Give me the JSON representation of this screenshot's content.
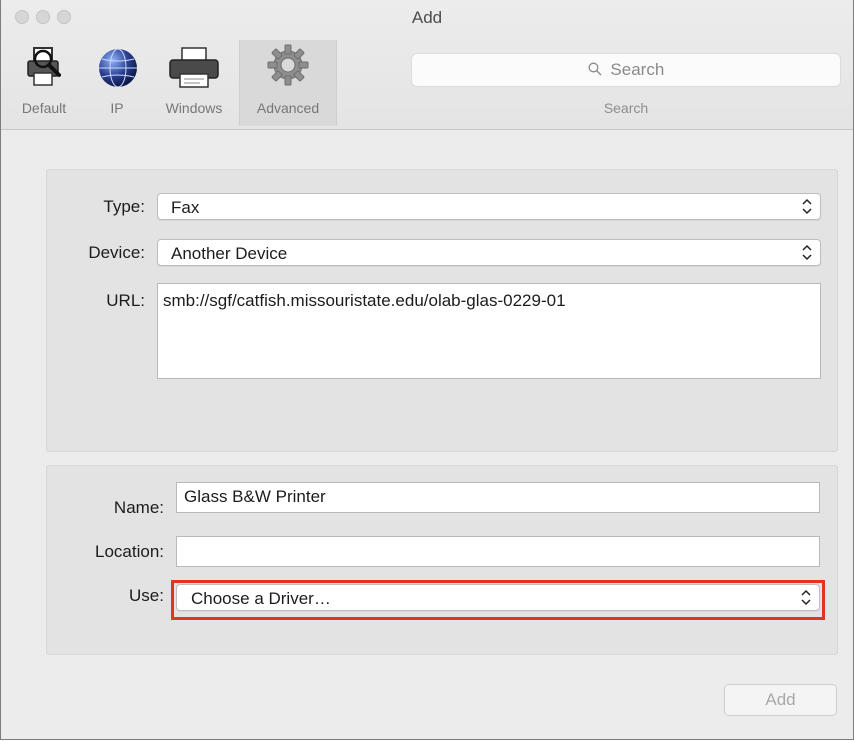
{
  "window": {
    "title": "Add"
  },
  "toolbar": {
    "items": [
      {
        "label": "Default",
        "icon": "default-printer-icon"
      },
      {
        "label": "IP",
        "icon": "globe-icon"
      },
      {
        "label": "Windows",
        "icon": "printer-icon"
      },
      {
        "label": "Advanced",
        "icon": "gear-icon",
        "selected": true
      }
    ],
    "search": {
      "placeholder": "Search",
      "caption": "Search"
    }
  },
  "connection": {
    "type_label": "Type:",
    "type_value": "Fax",
    "device_label": "Device:",
    "device_value": "Another Device",
    "url_label": "URL:",
    "url_value": "smb://sgf/catfish.missouristate.edu/olab-glas-0229-01"
  },
  "printer": {
    "name_label": "Name:",
    "name_value": "Glass B&W Printer",
    "location_label": "Location:",
    "location_value": "",
    "use_label": "Use:",
    "use_value": "Choose a Driver…"
  },
  "footer": {
    "add_label": "Add"
  },
  "colors": {
    "highlight": "#e3341f",
    "window_bg": "#ececec",
    "group_bg": "#e3e3e3"
  }
}
